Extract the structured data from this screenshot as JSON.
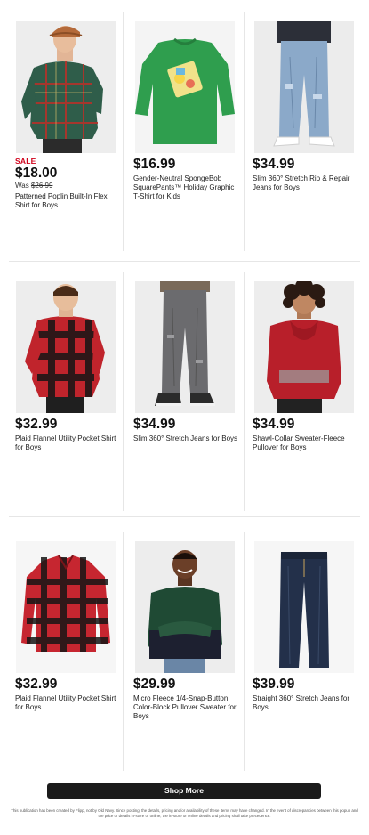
{
  "products": [
    {
      "sale_label": "SALE",
      "price": "$18.00",
      "was_label": "Was",
      "was_price": "$26.99",
      "name": "Patterned Poplin Built-In Flex Shirt for Boys"
    },
    {
      "price": "$16.99",
      "name": "Gender-Neutral SpongeBob SquarePants™ Holiday Graphic T-Shirt for Kids"
    },
    {
      "price": "$34.99",
      "name": "Slim 360° Stretch Rip & Repair Jeans for Boys"
    },
    {
      "price": "$32.99",
      "name": "Plaid Flannel Utility Pocket Shirt for Boys"
    },
    {
      "price": "$34.99",
      "name": "Slim 360° Stretch Jeans for Boys"
    },
    {
      "price": "$34.99",
      "name": "Shawl-Collar Sweater-Fleece Pullover for Boys"
    },
    {
      "price": "$32.99",
      "name": "Plaid Flannel Utility Pocket Shirt for Boys"
    },
    {
      "price": "$29.99",
      "name": "Micro Fleece 1/4-Snap-Button Color-Block Pullover Sweater for Boys"
    },
    {
      "price": "$39.99",
      "name": "Straight 360° Stretch Jeans for Boys"
    }
  ],
  "shop_more_label": "Shop More",
  "disclaimer": "This publication has been created by Flipp, not by Old Navy. Since posting, the details, pricing and/or availability of these items may have changed. In the event of discrepancies between this popup and the price or details in-store or online, the in-store or online details and pricing shall take precedence.",
  "colors": {
    "sale": "#d0021b",
    "button": "#1b1b1b",
    "divider": "#e6e6e6"
  }
}
